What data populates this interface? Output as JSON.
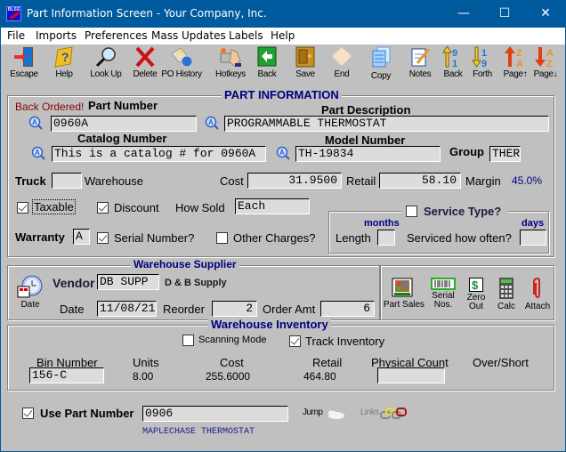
{
  "window": {
    "title": "Part Information Screen - Your Company, Inc.",
    "app_icon": "blss-app-icon",
    "controls": {
      "minimize": "—",
      "maximize": "☐",
      "close": "✕"
    }
  },
  "menu": [
    "File",
    "Imports",
    "Preferences",
    "Mass Updates",
    "Labels",
    "Help"
  ],
  "toolbar": [
    {
      "label": "Escape",
      "icon": "door-exit-icon"
    },
    {
      "label": "Help",
      "icon": "help-book-icon"
    },
    {
      "label": "Look Up",
      "icon": "magnifier-icon"
    },
    {
      "label": "Delete",
      "icon": "red-x-icon"
    },
    {
      "label": "PO History",
      "icon": "po-history-icon"
    },
    {
      "label": "Hotkeys",
      "icon": "keyboard-hand-icon"
    },
    {
      "label": "Back",
      "icon": "green-back-arrow-icon"
    },
    {
      "label": "Save",
      "icon": "safe-icon"
    },
    {
      "label": "End",
      "icon": "eraser-icon"
    },
    {
      "label": "Copy",
      "icon": "copy-pages-icon"
    },
    {
      "label": "Notes",
      "icon": "notepad-pencil-icon"
    },
    {
      "label": "Back",
      "icon": "sort-back-icon"
    },
    {
      "label": "Forth",
      "icon": "sort-forth-icon"
    },
    {
      "label": "Page↑",
      "icon": "page-up-za-icon"
    },
    {
      "label": "Page↓",
      "icon": "page-down-az-icon"
    }
  ],
  "part_info": {
    "section_title": "PART INFORMATION",
    "back_ordered": "Back Ordered!",
    "part_number_label": "Part Number",
    "part_number": "0960A",
    "part_description_label": "Part Description",
    "part_description": "PROGRAMMABLE THERMOSTAT",
    "catalog_number_label": "Catalog Number",
    "catalog_number": "This is a catalog # for 0960A",
    "model_number_label": "Model Number",
    "model_number": "TH-19834",
    "group_label": "Group",
    "group": "THER",
    "truck_label": "Truck",
    "truck": "",
    "warehouse_label": "Warehouse",
    "cost_label": "Cost",
    "cost": "31.9500",
    "retail_label": "Retail",
    "retail": "58.10",
    "margin_label": "Margin",
    "margin": "45.0%",
    "taxable_label": "Taxable",
    "taxable": true,
    "discount_label": "Discount",
    "discount": true,
    "how_sold_label": "How Sold",
    "how_sold": "Each",
    "warranty_label": "Warranty",
    "warranty": "A",
    "serial_number_label": "Serial Number?",
    "serial_number": true,
    "other_charges_label": "Other Charges?",
    "other_charges": false
  },
  "service": {
    "title": "Service Type?",
    "checked": false,
    "months_label": "months",
    "days_label": "days",
    "length_label": "Length",
    "length": "",
    "serviced_label": "Serviced how often?",
    "serviced": ""
  },
  "supplier": {
    "section_title": "Warehouse Supplier",
    "date_button_label": "Date",
    "vendor_label": "Vendor",
    "vendor": "DB SUPP",
    "vendor_name": "D & B Supply",
    "date_label": "Date",
    "date": "11/08/21",
    "reorder_label": "Reorder",
    "reorder": "2",
    "order_amt_label": "Order Amt",
    "order_amt": "6"
  },
  "side_buttons": [
    {
      "label": "Part Sales",
      "icon": "part-sales-icon"
    },
    {
      "label": "Serial\nNos.",
      "icon": "barcode-icon"
    },
    {
      "label": "Zero\nOut",
      "icon": "dollar-icon"
    },
    {
      "label": "Calc",
      "icon": "calculator-icon"
    },
    {
      "label": "Attach",
      "icon": "paperclip-icon"
    }
  ],
  "inventory": {
    "section_title": "Warehouse Inventory",
    "scanning_mode_label": "Scanning Mode",
    "scanning_mode": false,
    "track_inventory_label": "Track Inventory",
    "track_inventory": true,
    "columns": [
      "Bin Number",
      "Units",
      "Cost",
      "Retail",
      "Physical Count",
      "Over/Short"
    ],
    "bin_number": "156-C",
    "units": "8.00",
    "cost": "255.6000",
    "retail": "464.80",
    "physical_count": "",
    "over_short": ""
  },
  "use_part": {
    "label": "Use Part Number",
    "checked": true,
    "value": "0906",
    "description": "MAPLECHASE THERMOSTAT",
    "jump_label": "Jump",
    "links_label": "Links"
  },
  "colors": {
    "titlebar": "#005a9e",
    "section_title": "#000080",
    "back_ordered": "#8b0000",
    "margin": "#000080"
  }
}
